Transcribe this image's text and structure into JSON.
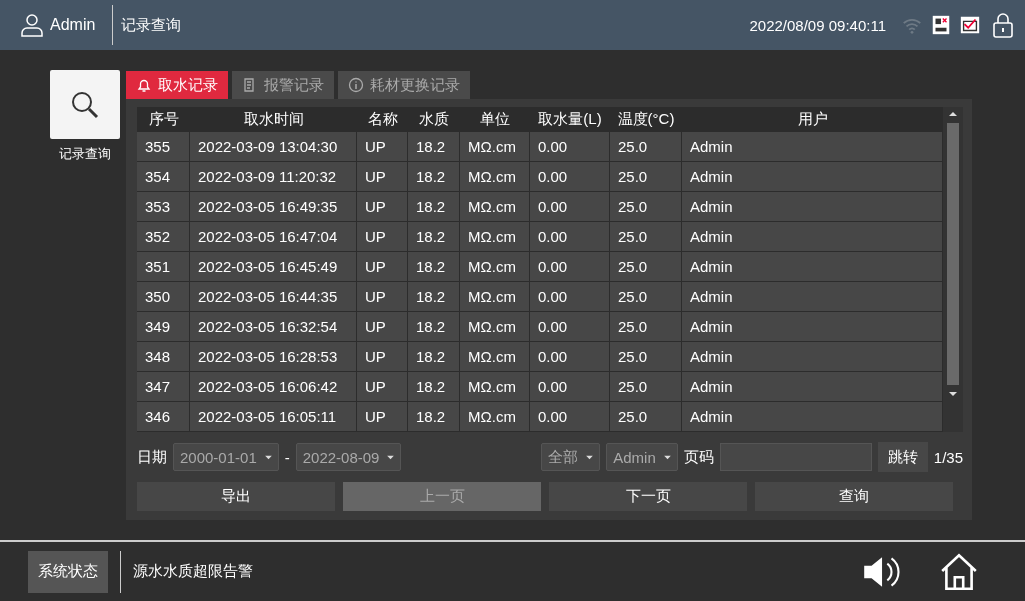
{
  "header": {
    "user": "Admin",
    "title": "记录查询",
    "datetime": "2022/08/09 09:40:11"
  },
  "sidebar": {
    "items": [
      {
        "label": "记录查询",
        "selected": true
      }
    ]
  },
  "tabs": [
    {
      "label": "取水记录",
      "selected": true,
      "kind": "bell"
    },
    {
      "label": "报警记录",
      "selected": false,
      "kind": "list"
    },
    {
      "label": "耗材更换记录",
      "selected": false,
      "kind": "info"
    }
  ],
  "table": {
    "columns": [
      "序号",
      "取水时间",
      "名称",
      "水质",
      "单位",
      "取水量(L)",
      "温度(°C)",
      "用户"
    ],
    "rows": [
      [
        "355",
        "2022-03-09 13:04:30",
        "UP",
        "18.2",
        "MΩ.cm",
        "0.00",
        "25.0",
        "Admin"
      ],
      [
        "354",
        "2022-03-09 11:20:32",
        "UP",
        "18.2",
        "MΩ.cm",
        "0.00",
        "25.0",
        "Admin"
      ],
      [
        "353",
        "2022-03-05 16:49:35",
        "UP",
        "18.2",
        "MΩ.cm",
        "0.00",
        "25.0",
        "Admin"
      ],
      [
        "352",
        "2022-03-05 16:47:04",
        "UP",
        "18.2",
        "MΩ.cm",
        "0.00",
        "25.0",
        "Admin"
      ],
      [
        "351",
        "2022-03-05 16:45:49",
        "UP",
        "18.2",
        "MΩ.cm",
        "0.00",
        "25.0",
        "Admin"
      ],
      [
        "350",
        "2022-03-05 16:44:35",
        "UP",
        "18.2",
        "MΩ.cm",
        "0.00",
        "25.0",
        "Admin"
      ],
      [
        "349",
        "2022-03-05 16:32:54",
        "UP",
        "18.2",
        "MΩ.cm",
        "0.00",
        "25.0",
        "Admin"
      ],
      [
        "348",
        "2022-03-05 16:28:53",
        "UP",
        "18.2",
        "MΩ.cm",
        "0.00",
        "25.0",
        "Admin"
      ],
      [
        "347",
        "2022-03-05 16:06:42",
        "UP",
        "18.2",
        "MΩ.cm",
        "0.00",
        "25.0",
        "Admin"
      ],
      [
        "346",
        "2022-03-05 16:05:11",
        "UP",
        "18.2",
        "MΩ.cm",
        "0.00",
        "25.0",
        "Admin"
      ]
    ]
  },
  "filters": {
    "date_label": "日期",
    "date_from": "2000-01-01",
    "separator": "-",
    "date_to": "2022-08-09",
    "type": "全部",
    "user": "Admin",
    "page_label": "页码",
    "jump": "跳转",
    "page_count": "1/35"
  },
  "buttons": [
    {
      "label": "导出",
      "disabled": false
    },
    {
      "label": "上一页",
      "disabled": true
    },
    {
      "label": "下一页",
      "disabled": false
    },
    {
      "label": "查询",
      "disabled": false
    }
  ],
  "footer": {
    "status_button": "系统状态",
    "message": "源水水质超限告警"
  }
}
